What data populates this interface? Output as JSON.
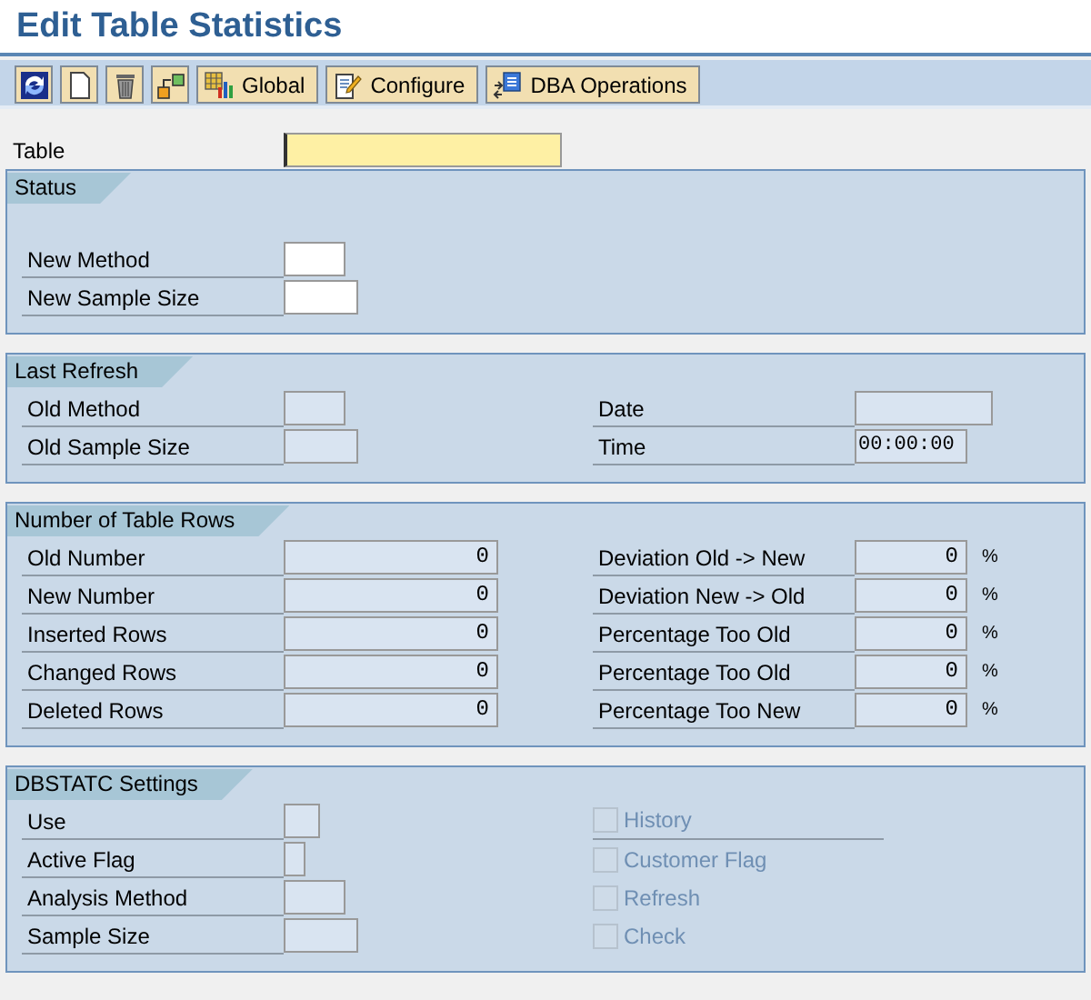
{
  "title": "Edit Table Statistics",
  "toolbar": [
    {
      "kind": "refresh"
    },
    {
      "kind": "new"
    },
    {
      "kind": "delete"
    },
    {
      "kind": "hierarchy"
    },
    {
      "kind": "global",
      "label": "Global"
    },
    {
      "kind": "configure",
      "label": "Configure"
    },
    {
      "kind": "dba",
      "label": "DBA Operations"
    }
  ],
  "table_field": {
    "label": "Table",
    "focused": true
  },
  "sections": [
    {
      "title": "Status",
      "left": [
        {
          "label": "New Method",
          "kind": "code",
          "disabled": false
        },
        {
          "label": "New Sample Size",
          "kind": "size",
          "disabled": false
        }
      ]
    },
    {
      "title": "Last Refresh",
      "left": [
        {
          "label": "Old Method",
          "kind": "code",
          "disabled": true
        },
        {
          "label": "Old Sample Size",
          "kind": "size",
          "disabled": true
        }
      ],
      "right": [
        {
          "label": "Date",
          "kind": "date",
          "disabled": true
        },
        {
          "label": "Time",
          "kind": "time",
          "value": "00:00:00",
          "disabled": true
        }
      ]
    },
    {
      "title": "Number of Table Rows",
      "left": [
        {
          "label": "Old Number",
          "kind": "count",
          "value": "0",
          "disabled": true
        },
        {
          "label": "New Number",
          "kind": "count",
          "value": "0",
          "disabled": true
        },
        {
          "label": "Inserted Rows",
          "kind": "count",
          "value": "0",
          "disabled": true
        },
        {
          "label": "Changed Rows",
          "kind": "count",
          "value": "0",
          "disabled": true
        },
        {
          "label": "Deleted Rows",
          "kind": "count",
          "value": "0",
          "disabled": true
        }
      ],
      "right": [
        {
          "label": "Deviation Old -> New",
          "kind": "percent",
          "value": "0",
          "unit": "%",
          "disabled": true
        },
        {
          "label": "Deviation New -> Old",
          "kind": "percent",
          "value": "0",
          "unit": "%",
          "disabled": true
        },
        {
          "label": "Percentage Too Old",
          "kind": "percent",
          "value": "0",
          "unit": "%",
          "disabled": true
        },
        {
          "label": "Percentage Too Old",
          "kind": "percent",
          "value": "0",
          "unit": "%",
          "disabled": true
        },
        {
          "label": "Percentage Too New",
          "kind": "percent",
          "value": "0",
          "unit": "%",
          "disabled": true
        }
      ]
    },
    {
      "title": "DBSTATC Settings",
      "left": [
        {
          "label": "Use",
          "kind": "char2",
          "disabled": true
        },
        {
          "label": "Active Flag",
          "kind": "char1",
          "disabled": true
        },
        {
          "label": "Analysis Method",
          "kind": "code",
          "disabled": true
        },
        {
          "label": "Sample Size",
          "kind": "size",
          "disabled": true
        }
      ],
      "right": [
        {
          "label": "History",
          "kind": "checkbox",
          "checked": false,
          "disabled": true
        },
        {
          "label": "Customer Flag",
          "kind": "checkbox",
          "checked": false,
          "disabled": true
        },
        {
          "label": "Refresh",
          "kind": "checkbox",
          "checked": false,
          "disabled": true
        },
        {
          "label": "Check",
          "kind": "checkbox",
          "checked": false,
          "disabled": true
        }
      ]
    }
  ]
}
